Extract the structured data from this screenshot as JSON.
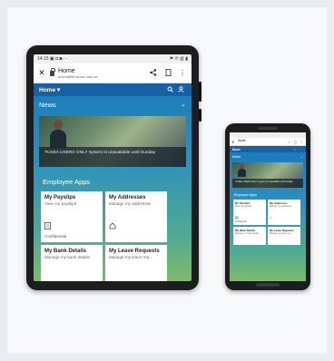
{
  "tablet": {
    "status": {
      "time": "14:15",
      "icons_left": "▣ ◘ ◙ ···",
      "icons_right": "⚑ ✆ ▥ ▮"
    },
    "browser": {
      "close": "✕",
      "title": "Home",
      "host": "onfonafilbora.ssn-fioe.se",
      "share_icon": "share-icon",
      "bookmark_icon": "bookmark-icon",
      "menu_icon": "menu-icon"
    },
    "shell": {
      "home": "Home ▾",
      "search_icon": "🔍",
      "user_icon": "👤"
    },
    "news": {
      "title": "News",
      "chevron": "⌄",
      "caption": "TUSEA USERS ONLY system is unavailable until Sunday"
    },
    "apps": {
      "title": "Employee Apps",
      "tiles": [
        {
          "title": "My Payslips",
          "subtitle": "View my payslips",
          "icon": "📄",
          "footer": "Confidential"
        },
        {
          "title": "My Addresses",
          "subtitle": "Manage my addresses",
          "icon": "⌂",
          "footer": ""
        },
        {
          "title": "My Bank Details",
          "subtitle": "Manage my bank details",
          "icon": "",
          "footer": ""
        },
        {
          "title": "My Leave Requests",
          "subtitle": "Manage my leave req...",
          "icon": "",
          "footer": ""
        }
      ]
    }
  },
  "phone": {
    "browser": {
      "close": "✕",
      "title": "Home"
    },
    "shell": {
      "home": "Home"
    },
    "news": {
      "title": "News",
      "caption": "TUSEA USERS ONLY system is unavailable until Sunday"
    },
    "apps": {
      "title": "Employee Apps",
      "tiles": [
        {
          "title": "My Payslips",
          "subtitle": "View my payslips",
          "icon": "📄",
          "footer": "Confidential"
        },
        {
          "title": "My Addresses",
          "subtitle": "Manage my addresses",
          "icon": "⌂",
          "footer": ""
        },
        {
          "title": "My Bank Details",
          "subtitle": "Manage my bank details",
          "icon": "",
          "footer": ""
        },
        {
          "title": "My Leave Requests",
          "subtitle": "Manage my leave req...",
          "icon": "",
          "footer": ""
        }
      ]
    }
  },
  "colors": {
    "shell_blue": "#1561a3",
    "gradient_top": "#1672b5",
    "gradient_bottom": "#7ebc6a",
    "device_frame": "#1d1d1f"
  }
}
